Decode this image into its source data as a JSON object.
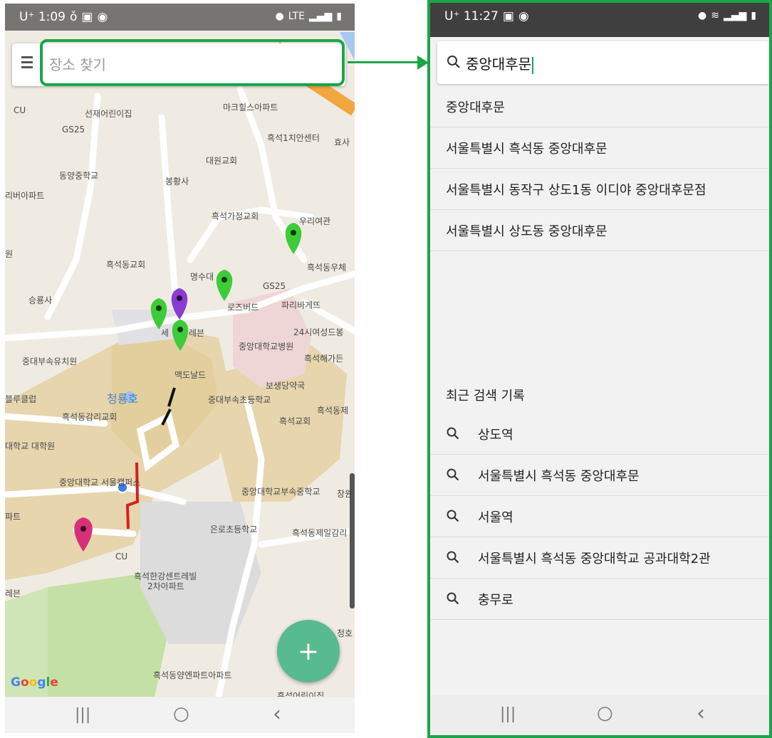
{
  "left_phone": {
    "status": {
      "time": "U⁺ 1:09",
      "network": "LTE"
    },
    "search": {
      "placeholder": "장소 찾기"
    },
    "map_labels": [
      "CU",
      "선재어린이집",
      "GS25",
      "마크힐스아파트",
      "흑석1치안센터",
      "효사",
      "대원교회",
      "동양중학교",
      "봉황사",
      "리버아파트",
      "흑석가정교회",
      "우리여관",
      "원",
      "흑석동교회",
      "명수대",
      "흑석동우체",
      "GS25",
      "승룡사",
      "로즈버드",
      "파리바게뜨",
      "세",
      "레븐",
      "24시여성드봉",
      "중앙대학교병원",
      "흑석해가든",
      "중대부속유치원",
      "맥도날드",
      "보생당약국",
      "블루클럽",
      "청룡호",
      "중대부속초등학교",
      "흑석동제",
      "흑석동감리교회",
      "흑석교회",
      "대학교 대학원",
      "중앙대학교 서울캠퍼스",
      "중앙대학교부속중학교",
      "창원",
      "파트",
      "은로초등학교",
      "흑석동제일감리",
      "CU",
      "흑석한강센트레빌",
      "2차아파트",
      "레븐",
      "청호",
      "흑석동양엔파트아파트",
      "흑석어린이집"
    ],
    "fab_label": "+",
    "google_logo": "Google",
    "nav": {
      "recents": "|||",
      "home": "○",
      "back": "‹"
    }
  },
  "right_phone": {
    "status": {
      "time": "U⁺ 11:27"
    },
    "search": {
      "query": "중앙대후문"
    },
    "suggestions": [
      "중앙대후문",
      "서울특별시 흑석동 중앙대후문",
      "서울특별시 동작구 상도1동 이디야 중앙대후문점",
      "서울특별시 상도동 중앙대후문"
    ],
    "recent_header": "최근 검색 기록",
    "recent": [
      "상도역",
      "서울특별시 흑석동 중앙대후문",
      "서울역",
      "서울특별시 흑석동 중앙대학교 공과대학2관",
      "충무로"
    ],
    "nav": {
      "recents": "|||",
      "home": "○",
      "back": "‹"
    }
  },
  "colors": {
    "highlight": "#19a64a",
    "fab": "#58ba8f",
    "pin_green": "#3ecb3a",
    "pin_purple": "#8a3bd1",
    "pin_pink": "#d6307a",
    "route_red": "#d61f1f"
  }
}
